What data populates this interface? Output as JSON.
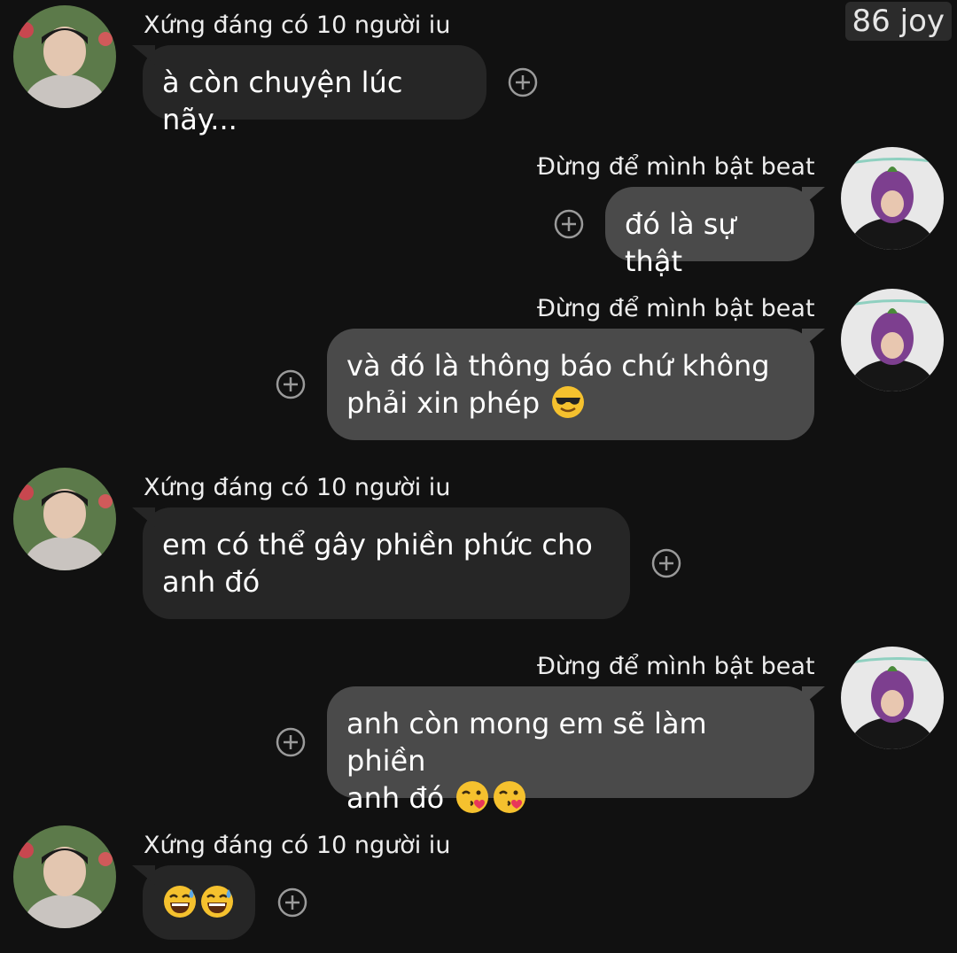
{
  "header": {
    "reaction_count": "86 joy"
  },
  "contacts": {
    "left": {
      "name": "Xứng đáng có 10 người iu"
    },
    "right": {
      "name": "Đừng để mình bật beat"
    }
  },
  "messages": [
    {
      "sender": "Xứng đáng có 10 người iu",
      "lines": [
        "à còn chuyện lúc nãy..."
      ]
    },
    {
      "sender": "Đừng để mình bật beat",
      "lines": [
        "đó là sự thật"
      ]
    },
    {
      "sender": "Đừng để mình bật beat",
      "lines": [
        "và đó là thông báo chứ không",
        "phải xin phép"
      ],
      "emoji": [
        "smiling-face-with-sunglasses"
      ]
    },
    {
      "sender": "Xứng đáng có 10 người iu",
      "lines": [
        "em có thể gây phiền phức cho",
        "anh đó"
      ]
    },
    {
      "sender": "Đừng để mình bật beat",
      "lines": [
        "anh còn mong em sẽ làm phiền",
        "anh đó"
      ],
      "emoji": [
        "face-blowing-a-kiss",
        "face-blowing-a-kiss"
      ]
    },
    {
      "sender": "Xứng đáng có 10 người iu",
      "lines": [],
      "emoji": [
        "grinning-face-with-sweat",
        "grinning-face-with-sweat"
      ]
    }
  ],
  "icons": {
    "reaction_add": "add-reaction-icon"
  },
  "colors": {
    "background": "#111111",
    "incoming_bubble": "#262626",
    "outgoing_bubble": "#4a4a4a",
    "text": "#ffffff"
  }
}
